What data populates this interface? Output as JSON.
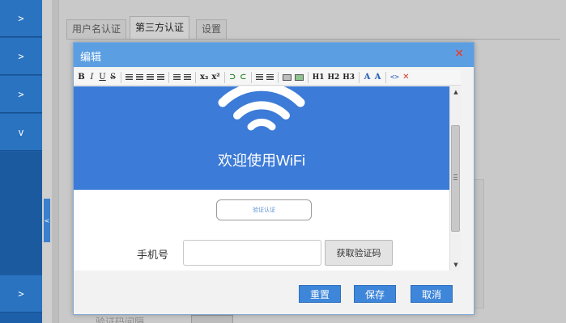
{
  "sidebar": {
    "items": [
      {
        "chevron": ">"
      },
      {
        "chevron": ">"
      },
      {
        "chevron": ">"
      },
      {
        "chevron": "v"
      },
      {
        "chevron": ">"
      }
    ],
    "collapse_handle": "<"
  },
  "background_tabs": [
    "用户名认证",
    "第三方认证",
    "设置"
  ],
  "background_footer_text": "验证码间隔",
  "modal": {
    "title": "编辑",
    "close": "×",
    "toolbar": [
      "B",
      "I",
      "U",
      "S",
      "x₂",
      "x²",
      "H1",
      "H2",
      "H3",
      "<>",
      "✕"
    ],
    "editor": {
      "banner_color": "#3c7bd7",
      "welcome_text": "欢迎使用WiFi",
      "auth_button": "验证认证",
      "phone_label": "手机号",
      "phone_value": "",
      "get_code_button": "获取验证码"
    },
    "buttons": {
      "reset": "重置",
      "save": "保存",
      "cancel": "取消"
    }
  },
  "colors": {
    "sidebar": "#2a73c0",
    "header": "#5b9fe2",
    "primary_button": "#3e86da",
    "close": "#e0443a"
  }
}
